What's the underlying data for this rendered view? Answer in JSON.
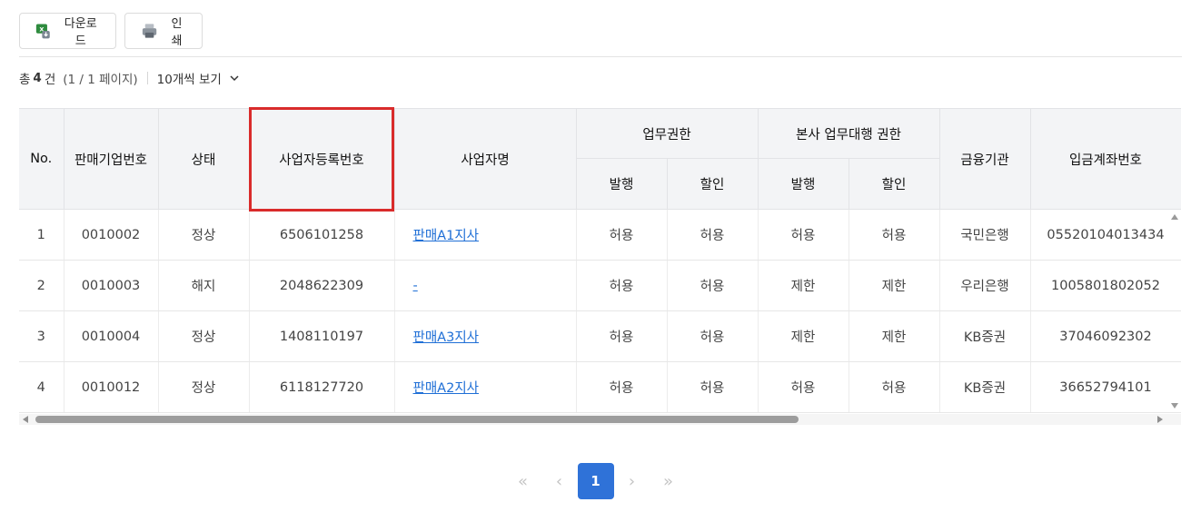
{
  "toolbar": {
    "download_label": "다운로드",
    "print_label": "인쇄"
  },
  "summary": {
    "total_prefix": "총",
    "total_count": "4",
    "total_suffix": "건",
    "page_info": "(1 / 1 페이지)",
    "per_page_label": "10개씩 보기"
  },
  "table": {
    "headers": {
      "no": "No.",
      "company_no": "판매기업번호",
      "status": "상태",
      "biz_reg_no": "사업자등록번호",
      "biz_name": "사업자명",
      "work_perm": "업무권한",
      "hq_perm": "본사 업무대행 권한",
      "issue": "발행",
      "discount": "할인",
      "bank": "금융기관",
      "account": "입금계좌번호"
    },
    "rows": [
      {
        "no": "1",
        "company_no": "0010002",
        "status": "정상",
        "biz_reg_no": "6506101258",
        "biz_name": "판매A1지사",
        "wp_issue": "허용",
        "wp_discount": "허용",
        "hq_issue": "허용",
        "hq_discount": "허용",
        "bank": "국민은행",
        "account": "05520104013434"
      },
      {
        "no": "2",
        "company_no": "0010003",
        "status": "해지",
        "biz_reg_no": "2048622309",
        "biz_name": "-",
        "wp_issue": "허용",
        "wp_discount": "허용",
        "hq_issue": "제한",
        "hq_discount": "제한",
        "bank": "우리은행",
        "account": "1005801802052"
      },
      {
        "no": "3",
        "company_no": "0010004",
        "status": "정상",
        "biz_reg_no": "1408110197",
        "biz_name": "판매A3지사",
        "wp_issue": "허용",
        "wp_discount": "허용",
        "hq_issue": "제한",
        "hq_discount": "제한",
        "bank": "KB증권",
        "account": "37046092302"
      },
      {
        "no": "4",
        "company_no": "0010012",
        "status": "정상",
        "biz_reg_no": "6118127720",
        "biz_name": "판매A2지사",
        "wp_issue": "허용",
        "wp_discount": "허용",
        "hq_issue": "허용",
        "hq_discount": "허용",
        "bank": "KB증권",
        "account": "36652794101"
      }
    ]
  },
  "pagination": {
    "first": "«",
    "prev": "‹",
    "current": "1",
    "next": "›",
    "last": "»"
  },
  "colors": {
    "accent": "#2f72d8",
    "highlight": "#d92b2b",
    "link": "#1f6fd6",
    "header_bg": "#f3f4f6"
  }
}
